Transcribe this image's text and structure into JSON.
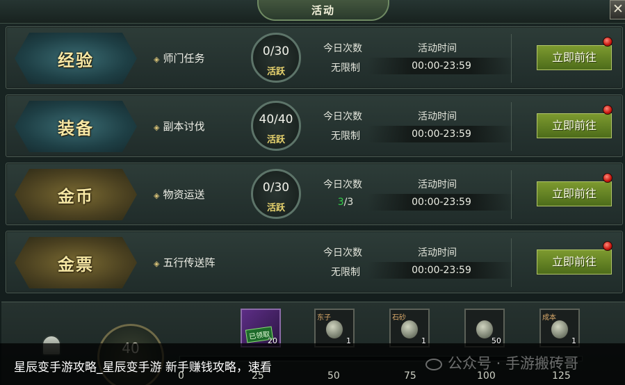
{
  "window": {
    "title": "活动",
    "close_glyph": "✕"
  },
  "activities": [
    {
      "category": "经验",
      "category_style": "blue",
      "task": "师门任务",
      "progress": "0/30",
      "progress_label": "活跃",
      "count_header": "今日次数",
      "count_value": "无限制",
      "time_header": "活动时间",
      "time_value": "00:00-23:59",
      "action": "立即前往"
    },
    {
      "category": "装备",
      "category_style": "blue",
      "task": "副本讨伐",
      "progress": "40/40",
      "progress_label": "活跃",
      "count_header": "今日次数",
      "count_value": "无限制",
      "time_header": "活动时间",
      "time_value": "00:00-23:59",
      "action": "立即前往"
    },
    {
      "category": "金币",
      "category_style": "gold",
      "task": "物资运送",
      "progress": "0/30",
      "progress_label": "活跃",
      "count_header": "今日次数",
      "count_done": "3",
      "count_total": "/3",
      "time_header": "活动时间",
      "time_value": "00:00-23:59",
      "action": "立即前往"
    },
    {
      "category": "金票",
      "category_style": "gold",
      "task": "五行传送阵",
      "count_header": "今日次数",
      "count_value": "无限制",
      "time_header": "活动时间",
      "time_value": "00:00-23:59",
      "action": "立即前往"
    }
  ],
  "activity_panel": {
    "current_points": "40",
    "milestones": [
      "0",
      "25",
      "50",
      "75",
      "100",
      "125"
    ],
    "rewards": [
      {
        "quantity": "20",
        "status": "已领取",
        "icon": "purple-chest-icon"
      },
      {
        "quantity": "1",
        "tag": "东子",
        "icon": "character-token-icon"
      },
      {
        "quantity": "1",
        "tag": "石砂",
        "icon": "character-token-icon"
      },
      {
        "quantity": "50",
        "icon": "orb-icon"
      },
      {
        "quantity": "1",
        "tag": "成本",
        "icon": "character-token-icon"
      }
    ]
  },
  "overlay": {
    "caption": "星辰变手游攻略_星辰变手游  新手赚钱攻略，速看",
    "watermark": "公众号 · 手游搬砖哥"
  }
}
